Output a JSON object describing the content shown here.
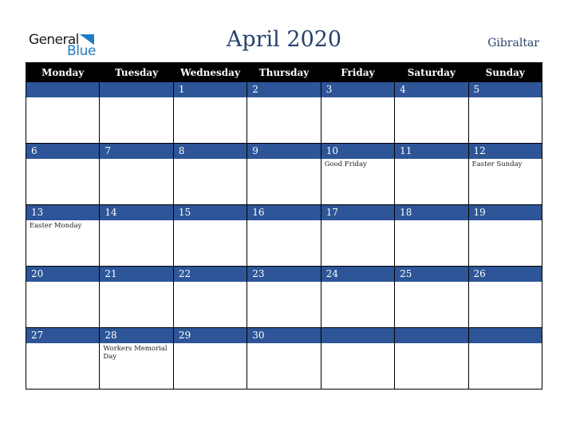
{
  "logo": {
    "general": "General",
    "blue": "Blue"
  },
  "header": {
    "title": "April 2020",
    "country": "Gibraltar"
  },
  "colors": {
    "accent": "#2d5597",
    "header_bg": "#000000",
    "title": "#26426b",
    "logo_blue": "#1e7bc4"
  },
  "weekdays": [
    "Monday",
    "Tuesday",
    "Wednesday",
    "Thursday",
    "Friday",
    "Saturday",
    "Sunday"
  ],
  "weeks": [
    [
      {
        "day": "",
        "holiday": ""
      },
      {
        "day": "",
        "holiday": ""
      },
      {
        "day": "1",
        "holiday": ""
      },
      {
        "day": "2",
        "holiday": ""
      },
      {
        "day": "3",
        "holiday": ""
      },
      {
        "day": "4",
        "holiday": ""
      },
      {
        "day": "5",
        "holiday": ""
      }
    ],
    [
      {
        "day": "6",
        "holiday": ""
      },
      {
        "day": "7",
        "holiday": ""
      },
      {
        "day": "8",
        "holiday": ""
      },
      {
        "day": "9",
        "holiday": ""
      },
      {
        "day": "10",
        "holiday": "Good Friday"
      },
      {
        "day": "11",
        "holiday": ""
      },
      {
        "day": "12",
        "holiday": "Easter Sunday"
      }
    ],
    [
      {
        "day": "13",
        "holiday": "Easter Monday"
      },
      {
        "day": "14",
        "holiday": ""
      },
      {
        "day": "15",
        "holiday": ""
      },
      {
        "day": "16",
        "holiday": ""
      },
      {
        "day": "17",
        "holiday": ""
      },
      {
        "day": "18",
        "holiday": ""
      },
      {
        "day": "19",
        "holiday": ""
      }
    ],
    [
      {
        "day": "20",
        "holiday": ""
      },
      {
        "day": "21",
        "holiday": ""
      },
      {
        "day": "22",
        "holiday": ""
      },
      {
        "day": "23",
        "holiday": ""
      },
      {
        "day": "24",
        "holiday": ""
      },
      {
        "day": "25",
        "holiday": ""
      },
      {
        "day": "26",
        "holiday": ""
      }
    ],
    [
      {
        "day": "27",
        "holiday": ""
      },
      {
        "day": "28",
        "holiday": "Workers Memorial Day"
      },
      {
        "day": "29",
        "holiday": ""
      },
      {
        "day": "30",
        "holiday": ""
      },
      {
        "day": "",
        "holiday": ""
      },
      {
        "day": "",
        "holiday": ""
      },
      {
        "day": "",
        "holiday": ""
      }
    ]
  ]
}
